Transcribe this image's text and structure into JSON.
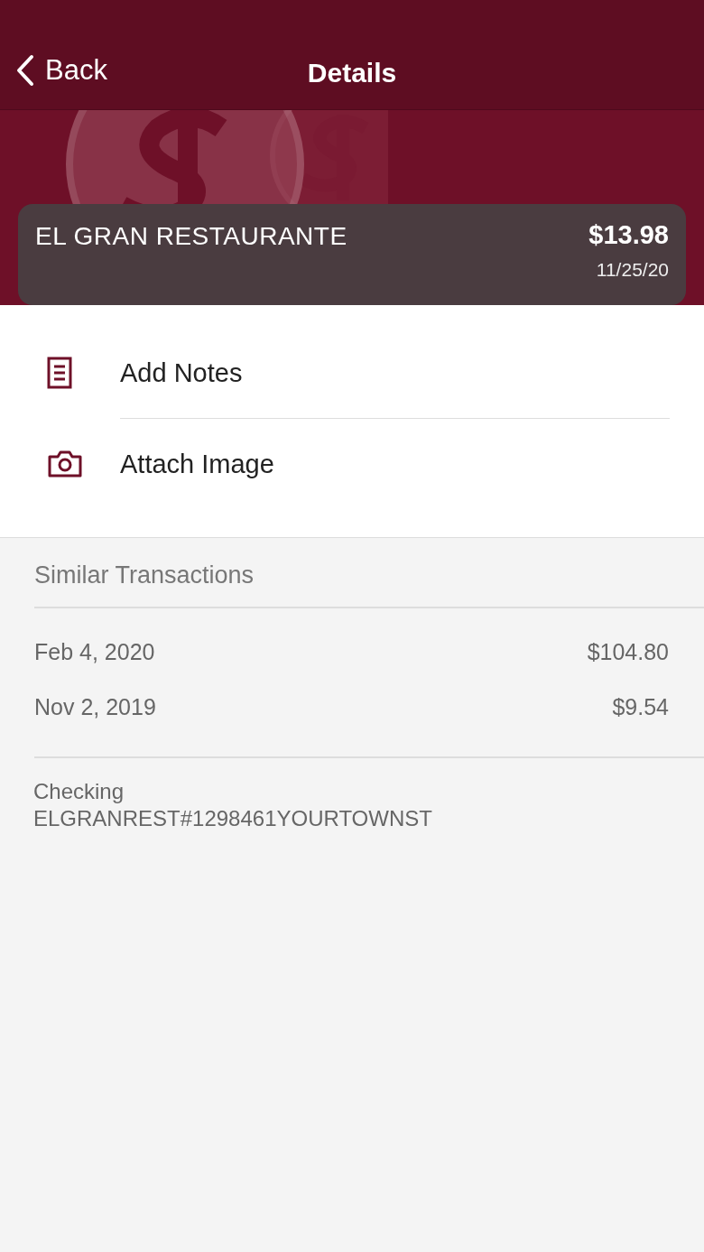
{
  "nav": {
    "back": "Back",
    "title": "Details"
  },
  "transaction": {
    "merchant": "EL GRAN RESTAURANTE",
    "amount": "$13.98",
    "date": "11/25/20"
  },
  "actions": [
    {
      "kind": "notes",
      "label": "Add Notes"
    },
    {
      "kind": "image",
      "label": "Attach Image"
    }
  ],
  "similar": {
    "title": "Similar Transactions",
    "rows": [
      {
        "date": "Feb 4, 2020",
        "amount": "$104.80"
      },
      {
        "date": "Nov 2, 2019",
        "amount": "$9.54"
      }
    ]
  },
  "account": {
    "name": "Checking",
    "description": "ELGRANREST#1298461YOURTOWNST"
  }
}
